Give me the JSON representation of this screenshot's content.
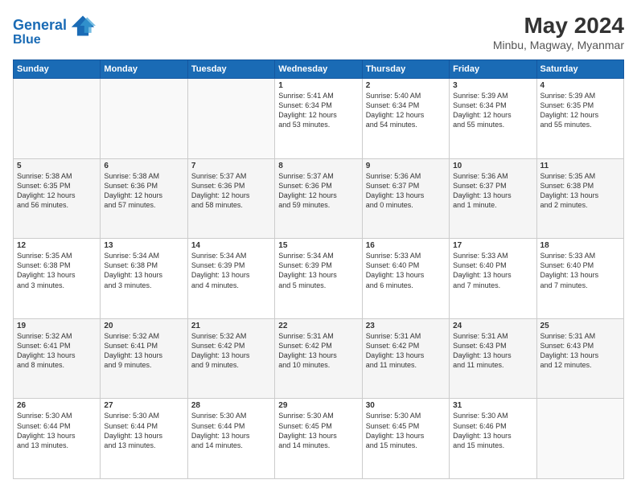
{
  "header": {
    "logo_line1": "General",
    "logo_line2": "Blue",
    "month": "May 2024",
    "location": "Minbu, Magway, Myanmar"
  },
  "weekdays": [
    "Sunday",
    "Monday",
    "Tuesday",
    "Wednesday",
    "Thursday",
    "Friday",
    "Saturday"
  ],
  "weeks": [
    [
      {
        "day": "",
        "info": ""
      },
      {
        "day": "",
        "info": ""
      },
      {
        "day": "",
        "info": ""
      },
      {
        "day": "1",
        "info": "Sunrise: 5:41 AM\nSunset: 6:34 PM\nDaylight: 12 hours\nand 53 minutes."
      },
      {
        "day": "2",
        "info": "Sunrise: 5:40 AM\nSunset: 6:34 PM\nDaylight: 12 hours\nand 54 minutes."
      },
      {
        "day": "3",
        "info": "Sunrise: 5:39 AM\nSunset: 6:34 PM\nDaylight: 12 hours\nand 55 minutes."
      },
      {
        "day": "4",
        "info": "Sunrise: 5:39 AM\nSunset: 6:35 PM\nDaylight: 12 hours\nand 55 minutes."
      }
    ],
    [
      {
        "day": "5",
        "info": "Sunrise: 5:38 AM\nSunset: 6:35 PM\nDaylight: 12 hours\nand 56 minutes."
      },
      {
        "day": "6",
        "info": "Sunrise: 5:38 AM\nSunset: 6:36 PM\nDaylight: 12 hours\nand 57 minutes."
      },
      {
        "day": "7",
        "info": "Sunrise: 5:37 AM\nSunset: 6:36 PM\nDaylight: 12 hours\nand 58 minutes."
      },
      {
        "day": "8",
        "info": "Sunrise: 5:37 AM\nSunset: 6:36 PM\nDaylight: 12 hours\nand 59 minutes."
      },
      {
        "day": "9",
        "info": "Sunrise: 5:36 AM\nSunset: 6:37 PM\nDaylight: 13 hours\nand 0 minutes."
      },
      {
        "day": "10",
        "info": "Sunrise: 5:36 AM\nSunset: 6:37 PM\nDaylight: 13 hours\nand 1 minute."
      },
      {
        "day": "11",
        "info": "Sunrise: 5:35 AM\nSunset: 6:38 PM\nDaylight: 13 hours\nand 2 minutes."
      }
    ],
    [
      {
        "day": "12",
        "info": "Sunrise: 5:35 AM\nSunset: 6:38 PM\nDaylight: 13 hours\nand 3 minutes."
      },
      {
        "day": "13",
        "info": "Sunrise: 5:34 AM\nSunset: 6:38 PM\nDaylight: 13 hours\nand 3 minutes."
      },
      {
        "day": "14",
        "info": "Sunrise: 5:34 AM\nSunset: 6:39 PM\nDaylight: 13 hours\nand 4 minutes."
      },
      {
        "day": "15",
        "info": "Sunrise: 5:34 AM\nSunset: 6:39 PM\nDaylight: 13 hours\nand 5 minutes."
      },
      {
        "day": "16",
        "info": "Sunrise: 5:33 AM\nSunset: 6:40 PM\nDaylight: 13 hours\nand 6 minutes."
      },
      {
        "day": "17",
        "info": "Sunrise: 5:33 AM\nSunset: 6:40 PM\nDaylight: 13 hours\nand 7 minutes."
      },
      {
        "day": "18",
        "info": "Sunrise: 5:33 AM\nSunset: 6:40 PM\nDaylight: 13 hours\nand 7 minutes."
      }
    ],
    [
      {
        "day": "19",
        "info": "Sunrise: 5:32 AM\nSunset: 6:41 PM\nDaylight: 13 hours\nand 8 minutes."
      },
      {
        "day": "20",
        "info": "Sunrise: 5:32 AM\nSunset: 6:41 PM\nDaylight: 13 hours\nand 9 minutes."
      },
      {
        "day": "21",
        "info": "Sunrise: 5:32 AM\nSunset: 6:42 PM\nDaylight: 13 hours\nand 9 minutes."
      },
      {
        "day": "22",
        "info": "Sunrise: 5:31 AM\nSunset: 6:42 PM\nDaylight: 13 hours\nand 10 minutes."
      },
      {
        "day": "23",
        "info": "Sunrise: 5:31 AM\nSunset: 6:42 PM\nDaylight: 13 hours\nand 11 minutes."
      },
      {
        "day": "24",
        "info": "Sunrise: 5:31 AM\nSunset: 6:43 PM\nDaylight: 13 hours\nand 11 minutes."
      },
      {
        "day": "25",
        "info": "Sunrise: 5:31 AM\nSunset: 6:43 PM\nDaylight: 13 hours\nand 12 minutes."
      }
    ],
    [
      {
        "day": "26",
        "info": "Sunrise: 5:30 AM\nSunset: 6:44 PM\nDaylight: 13 hours\nand 13 minutes."
      },
      {
        "day": "27",
        "info": "Sunrise: 5:30 AM\nSunset: 6:44 PM\nDaylight: 13 hours\nand 13 minutes."
      },
      {
        "day": "28",
        "info": "Sunrise: 5:30 AM\nSunset: 6:44 PM\nDaylight: 13 hours\nand 14 minutes."
      },
      {
        "day": "29",
        "info": "Sunrise: 5:30 AM\nSunset: 6:45 PM\nDaylight: 13 hours\nand 14 minutes."
      },
      {
        "day": "30",
        "info": "Sunrise: 5:30 AM\nSunset: 6:45 PM\nDaylight: 13 hours\nand 15 minutes."
      },
      {
        "day": "31",
        "info": "Sunrise: 5:30 AM\nSunset: 6:46 PM\nDaylight: 13 hours\nand 15 minutes."
      },
      {
        "day": "",
        "info": ""
      }
    ]
  ]
}
